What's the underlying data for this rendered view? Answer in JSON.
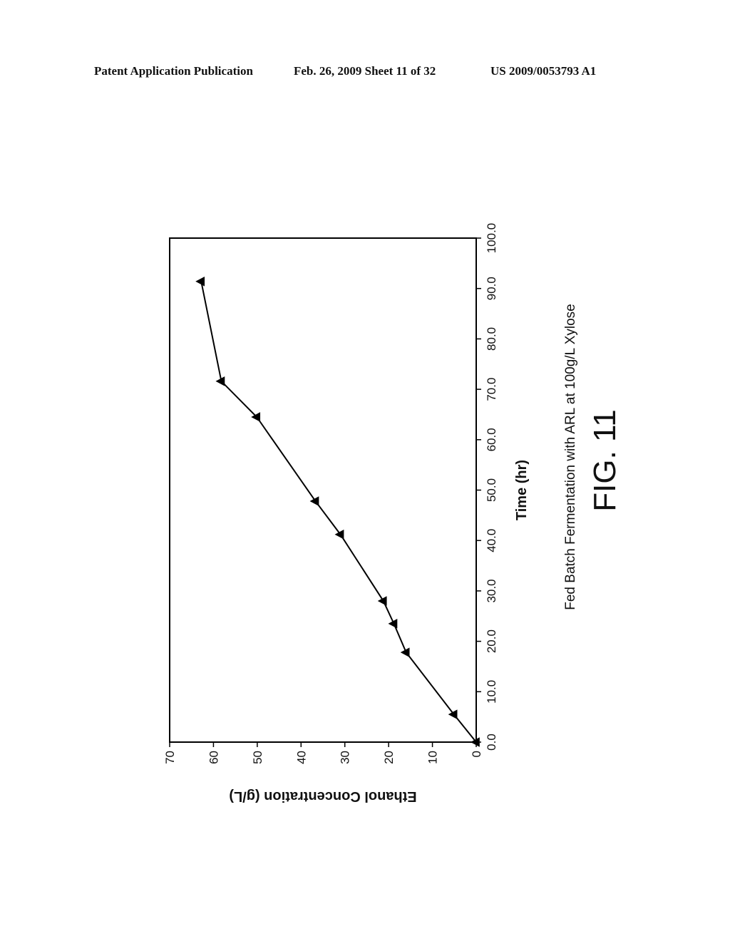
{
  "header": {
    "left": "Patent Application Publication",
    "middle": "Feb. 26, 2009   Sheet 11 of 32",
    "right": "US 2009/0053793 A1"
  },
  "figure": {
    "label": "FIG. 11",
    "caption": "Fed Batch Fermentation with ARL at 100g/L Xylose",
    "orientation": "rotated 90 degrees counter-clockwise on page",
    "line_color": "#000000"
  },
  "chart_data": {
    "type": "line",
    "title": "Fed Batch Fermentation with ARL at 100g/L Xylose",
    "xlabel": "Time (hr)",
    "ylabel": "Ethanol Concentration (g/L)",
    "xlim": [
      0,
      100
    ],
    "ylim": [
      0,
      70
    ],
    "x_ticks": [
      "0.0",
      "10.0",
      "20.0",
      "30.0",
      "40.0",
      "50.0",
      "60.0",
      "70.0",
      "80.0",
      "90.0",
      "100.0"
    ],
    "y_ticks": [
      "0",
      "10",
      "20",
      "30",
      "40",
      "50",
      "60",
      "70"
    ],
    "grid": false,
    "legend": "none",
    "marker": "triangle-up",
    "series": [
      {
        "name": "Ethanol",
        "x": [
          0.0,
          5.5,
          17.8,
          23.5,
          28.0,
          41.2,
          47.8,
          64.5,
          71.6,
          91.4
        ],
        "y": [
          0.0,
          5.1,
          16.0,
          18.8,
          21.2,
          31.0,
          36.7,
          50.1,
          58.2,
          62.8
        ]
      }
    ]
  }
}
